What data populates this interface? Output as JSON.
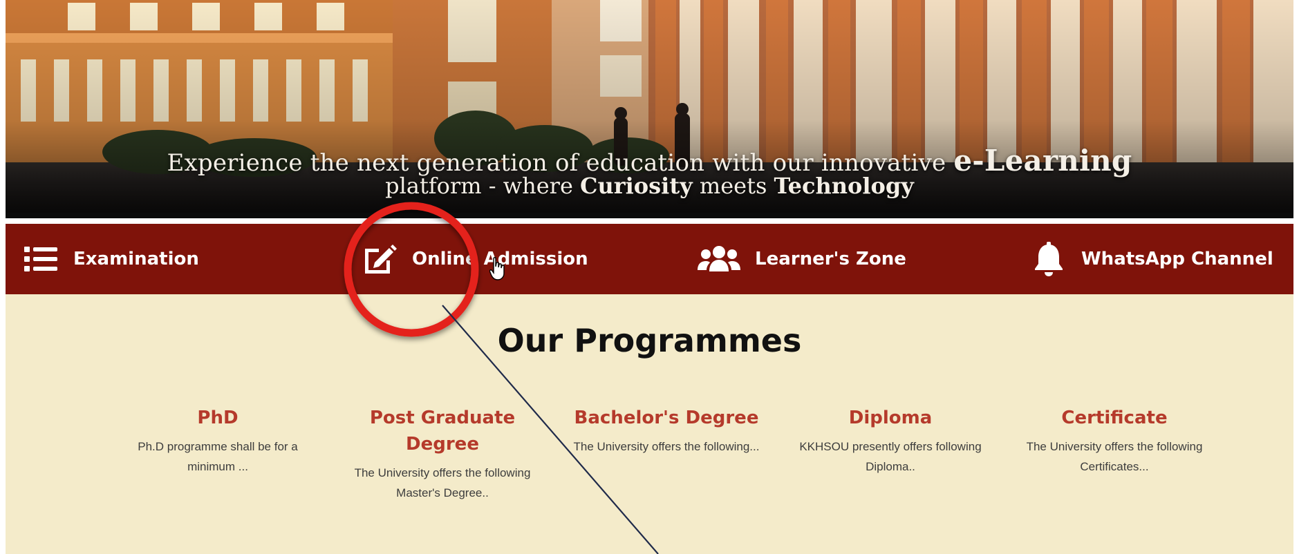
{
  "hero": {
    "caption_line1_pre": "Experience the next generation of education with our innovative",
    "caption_line1_strong": "e-Learning",
    "caption_line2_pre": "platform - where",
    "caption_line2_b1": "Curiosity",
    "caption_line2_mid": "meets",
    "caption_line2_b2": "Technology"
  },
  "nav": {
    "items": [
      {
        "label": "Examination",
        "icon": "list-icon"
      },
      {
        "label": "Online Admission",
        "icon": "edit-icon"
      },
      {
        "label": "Learner's Zone",
        "icon": "users-icon"
      },
      {
        "label": "WhatsApp Channel",
        "icon": "bell-icon"
      }
    ]
  },
  "programmes": {
    "title": "Our Programmes",
    "items": [
      {
        "name": "PhD",
        "desc": "Ph.D programme shall be for a minimum ..."
      },
      {
        "name": "Post Graduate Degree",
        "desc": "The University offers the following Master's Degree.."
      },
      {
        "name": "Bachelor's Degree",
        "desc": "The University offers the following..."
      },
      {
        "name": "Diploma",
        "desc": "KKHSOU presently offers following Diploma.."
      },
      {
        "name": "Certificate",
        "desc": "The University offers the following Certificates..."
      }
    ]
  },
  "colors": {
    "nav_bg": "#7f130a",
    "section_bg": "#f4ebca",
    "programme_title": "#b53a2b",
    "highlight_circle": "#e4201a"
  }
}
